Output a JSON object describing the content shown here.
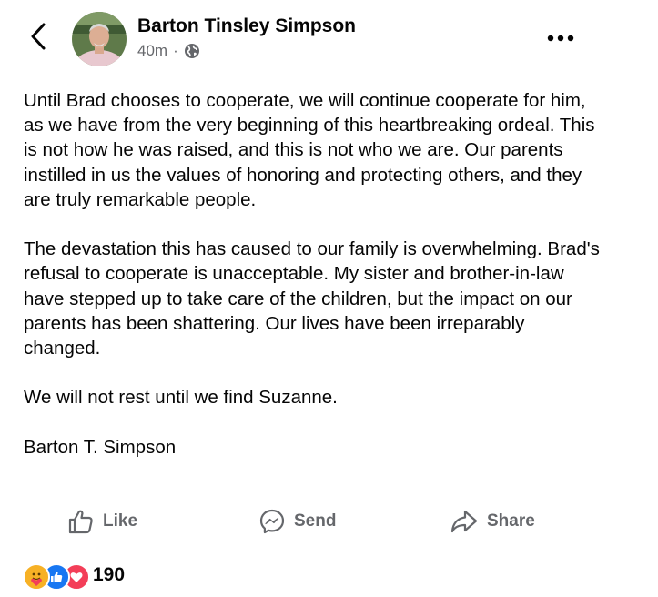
{
  "header": {
    "back_icon": "chevron-left-icon",
    "author_name": "Barton Tinsley Simpson",
    "time": "40m",
    "separator": "·",
    "privacy_icon": "globe-icon",
    "more_icon": "more-horizontal-icon"
  },
  "post": {
    "paragraphs": [
      "Until Brad chooses to cooperate, we will continue cooperate for him, as we have from the very beginning of this heartbreaking ordeal. This is not how he was raised, and this is not who we are. Our parents instilled in us the values of honoring and protecting others, and they are truly remarkable people.",
      "The devastation this has caused to our family is overwhelming. Brad's refusal to cooperate is unacceptable. My sister and brother-in-law have stepped up to take care of the children, but the impact on our parents has been shattering. Our lives have been irreparably changed.",
      "We will not rest until we find Suzanne.",
      "Barton T. Simpson"
    ]
  },
  "actions": {
    "like_label": "Like",
    "send_label": "Send",
    "share_label": "Share"
  },
  "reactions": {
    "types": [
      "care",
      "like",
      "love"
    ],
    "count": "190"
  },
  "colors": {
    "text": "#050505",
    "secondary": "#65676b",
    "like_blue": "#1877f2",
    "love_red": "#f33e58",
    "care_yellow": "#f7b125"
  }
}
